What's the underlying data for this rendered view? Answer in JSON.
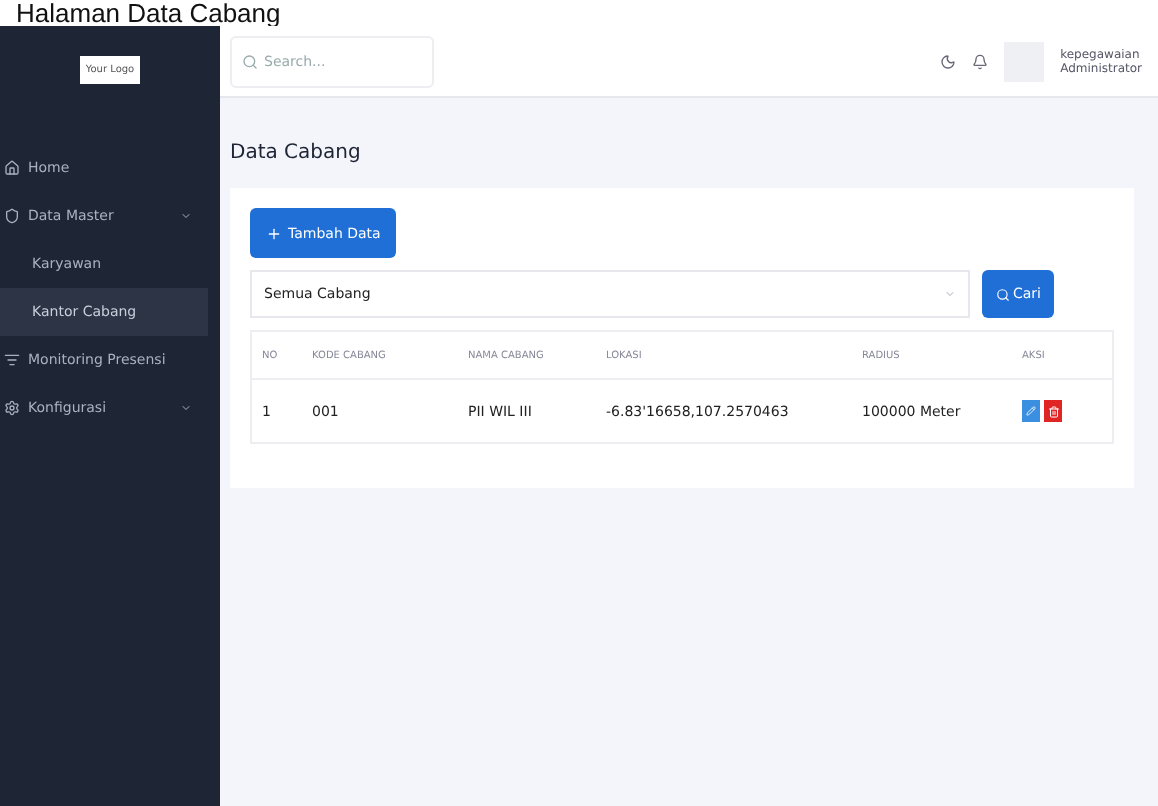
{
  "caption": "Halaman Data Cabang",
  "sidebar": {
    "logo_text": "Your Logo",
    "items": [
      {
        "label": "Home",
        "selected": false,
        "collapsible": false
      },
      {
        "label": "Data Master",
        "selected": false,
        "collapsible": true,
        "children": [
          {
            "label": "Karyawan",
            "selected": false
          },
          {
            "label": "Kantor Cabang",
            "selected": true
          }
        ]
      },
      {
        "label": "Monitoring Presensi",
        "selected": false,
        "collapsible": false
      },
      {
        "label": "Konfigurasi",
        "selected": false,
        "collapsible": true
      }
    ]
  },
  "topbar": {
    "search": {
      "placeholder": "Search..."
    },
    "user": {
      "name": "kepegawaian",
      "role": "Administrator"
    }
  },
  "page_title": "Data Cabang",
  "add_button": "Tambah Data",
  "filter": {
    "value": "Semua Cabang",
    "button": "Cari"
  },
  "table": {
    "columns": [
      "NO",
      "KODE CABANG",
      "NAMA CABANG",
      "LOKASI",
      "RADIUS",
      "AKSI"
    ],
    "rows": [
      [
        "1",
        "001",
        "PII WIL III",
        "-6.83'16658,107.2570463",
        "100000 Meter"
      ]
    ]
  }
}
